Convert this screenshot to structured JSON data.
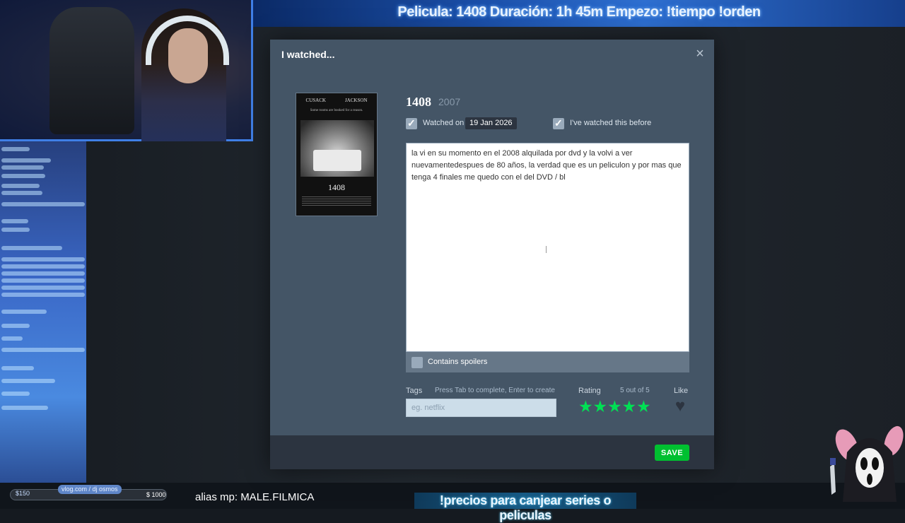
{
  "overlay": {
    "top_banner": "Pelicula: 1408 Duración: 1h 45m Empezo: !tiempo !orden",
    "goal_value": "$150",
    "goal_max": "$ 1000",
    "vlog_tag": "vlog.com / dj osmos",
    "alias": "alias mp: MALE.FILMICA",
    "bottom_banner": "!precios para canjear series o peliculas"
  },
  "modal": {
    "title": "I watched...",
    "close_icon": "×",
    "poster": {
      "actor_left": "CUSACK",
      "actor_right": "JACKSON",
      "tagline": "Some rooms are booked for a reason.",
      "title": "1408"
    },
    "film": {
      "title": "1408",
      "year": "2007"
    },
    "watched_on": {
      "label": "Watched on",
      "checked": true,
      "date": "19 Jan 2026"
    },
    "watched_before": {
      "label": "I've watched this before",
      "checked": true
    },
    "review_text": "la vi en su momento en el 2008 alquilada por dvd y la volvi a ver nuevamentedespues de 80 años, la verdad que es un peliculon y por mas que tenga 4 finales me quedo con el del DVD / bl",
    "spoilers": {
      "label": "Contains spoilers",
      "checked": false
    },
    "tags": {
      "label": "Tags",
      "hint": "Press Tab to complete, Enter to create",
      "placeholder": "eg. netflix",
      "value": ""
    },
    "rating": {
      "label": "Rating",
      "summary": "5 out of 5",
      "value": 5,
      "max": 5,
      "star_glyph": "★",
      "color": "#00e054"
    },
    "like": {
      "label": "Like",
      "liked": false,
      "icon_glyph": "♥"
    },
    "save_label": "SAVE"
  }
}
